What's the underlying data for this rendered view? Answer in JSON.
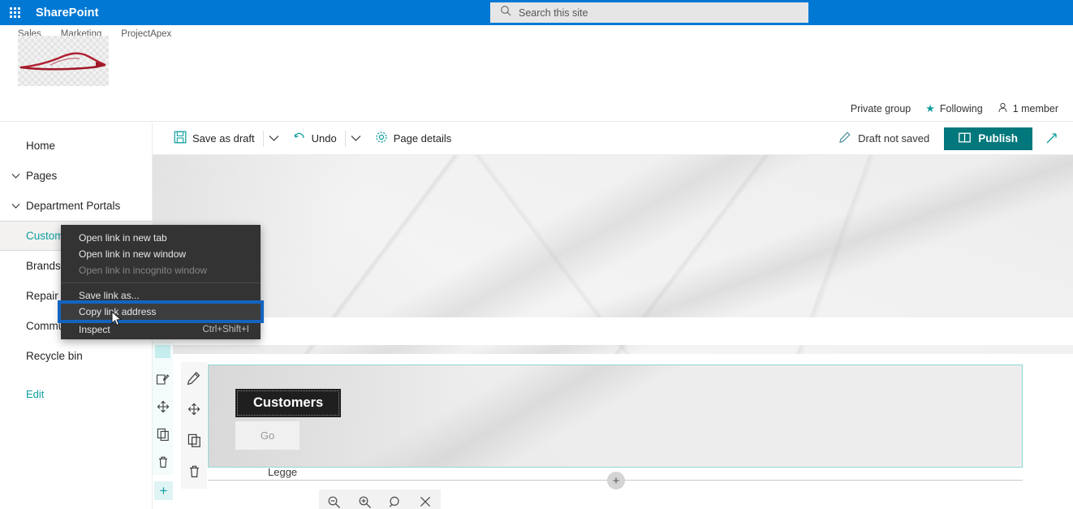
{
  "suite": {
    "waffle_icon": "app-launcher-icon",
    "brand": "SharePoint",
    "search": {
      "icon": "search-icon",
      "placeholder": "Search this site",
      "value": ""
    }
  },
  "site_header": {
    "hub_nav": [
      "Sales",
      "Marketing",
      "ProjectApex"
    ],
    "logo_icon": "site-logo-car-sketch",
    "meta": {
      "privacy": "Private group",
      "following_icon": "star-icon",
      "following": "Following",
      "members_icon": "person-icon",
      "members": "1 member"
    }
  },
  "command_bar": {
    "save_icon": "save-icon",
    "save_label": "Save as draft",
    "save_chevron_icon": "chevron-down-icon",
    "undo_icon": "undo-icon",
    "undo_label": "Undo",
    "undo_chevron_icon": "chevron-down-icon",
    "page_details_icon": "gear-icon",
    "page_details_label": "Page details",
    "draft_icon": "pencil-icon",
    "draft_status": "Draft not saved",
    "publish_icon": "publish-icon",
    "publish_label": "Publish",
    "expand_icon": "expand-icon"
  },
  "left_nav": {
    "items": [
      {
        "label": "Home",
        "chevron": false,
        "selected": false
      },
      {
        "label": "Pages",
        "chevron": true,
        "selected": false
      },
      {
        "label": "Department Portals",
        "chevron": true,
        "selected": false
      },
      {
        "label": "Customers",
        "chevron": false,
        "selected": true
      },
      {
        "label": "Brands",
        "chevron": false,
        "selected": false
      },
      {
        "label": "Repair Shops",
        "chevron": false,
        "selected": false
      },
      {
        "label": "Communities",
        "chevron": false,
        "selected": false
      },
      {
        "label": "Recycle bin",
        "chevron": false,
        "selected": false
      }
    ],
    "edit_label": "Edit"
  },
  "context_menu": {
    "items": [
      {
        "label": "Open link in new tab",
        "shortcut": "",
        "state": "normal"
      },
      {
        "label": "Open link in new window",
        "shortcut": "",
        "state": "normal"
      },
      {
        "label": "Open link in incognito window",
        "shortcut": "",
        "state": "disabled"
      },
      {
        "label": "Save link as...",
        "shortcut": "",
        "state": "normal"
      },
      {
        "label": "Copy link address",
        "shortcut": "",
        "state": "highlighted"
      },
      {
        "label": "Inspect",
        "shortcut": "Ctrl+Shift+I",
        "state": "normal"
      }
    ]
  },
  "zoom_toolbar": {
    "zoom_out_icon": "zoom-out-icon",
    "zoom_in_icon": "zoom-in-icon",
    "zoom_reset_icon": "zoom-reset-icon",
    "close_icon": "close-icon"
  },
  "section_toolbar": {
    "drag_handle_icon": "drag-handle-icon",
    "icons": [
      "edit-section-icon",
      "move-section-icon",
      "duplicate-section-icon",
      "delete-section-icon"
    ]
  },
  "webpart_toolbar": {
    "icons": [
      "edit-webpart-icon",
      "move-webpart-icon",
      "duplicate-webpart-icon",
      "delete-webpart-icon"
    ]
  },
  "canvas": {
    "hero_caption": "Legge",
    "add_section_left_label": "+",
    "add_section_center_label": "+",
    "webpart": {
      "title": "Customers",
      "button_label": "Go"
    }
  }
}
